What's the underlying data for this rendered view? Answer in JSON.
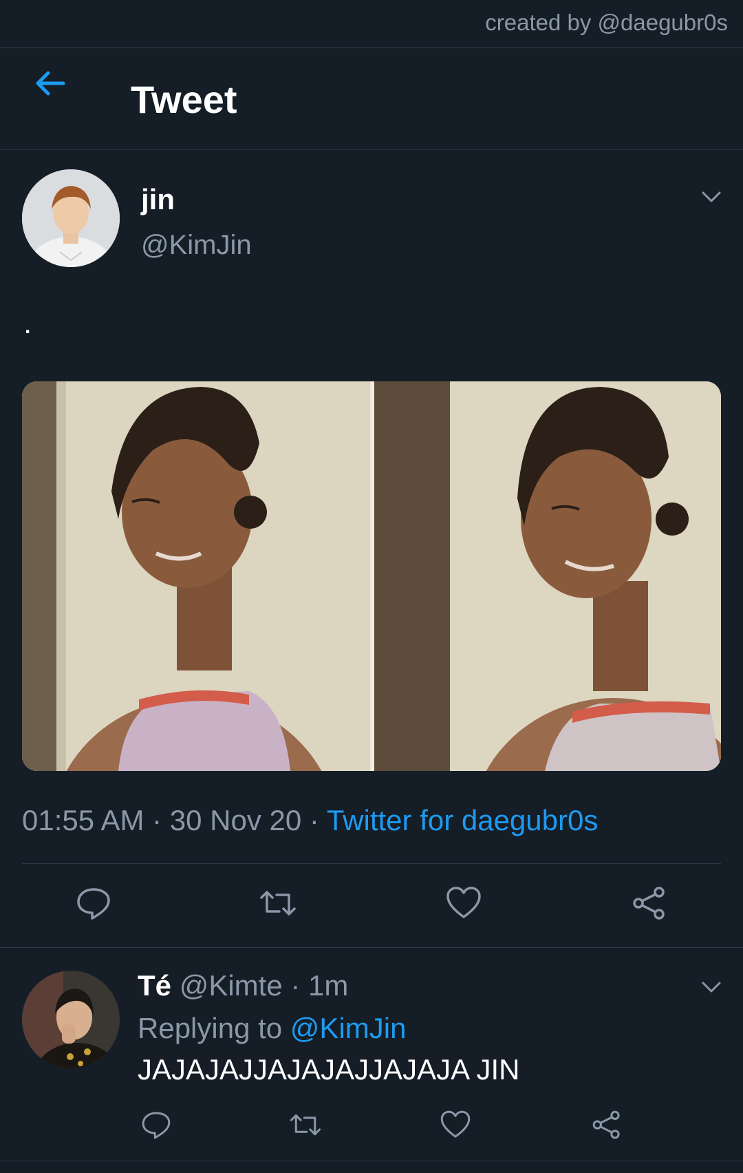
{
  "watermark": "created by @daegubr0s",
  "header": {
    "title": "Tweet",
    "back_icon": "arrow-left-icon"
  },
  "tweet": {
    "author_name": "jin",
    "author_handle": "@KimJin",
    "text": ".",
    "time": "01:55 AM",
    "date": "30 Nov 20",
    "separator": " · ",
    "source": "Twitter for daegubr0s"
  },
  "actions": [
    "reply-icon",
    "retweet-icon",
    "like-icon",
    "share-icon"
  ],
  "reply": {
    "name": "Té",
    "handle": "@Kimte",
    "time": "1m",
    "dot": " · ",
    "replying_prefix": "Replying to ",
    "replying_to": "@KimJin",
    "text": "JAJAJAJJAJAJAJJAJAJA JIN"
  },
  "colors": {
    "background": "#151d27",
    "accent": "#1d9bf0",
    "muted": "#8a98a8",
    "divider": "#2d3844"
  }
}
